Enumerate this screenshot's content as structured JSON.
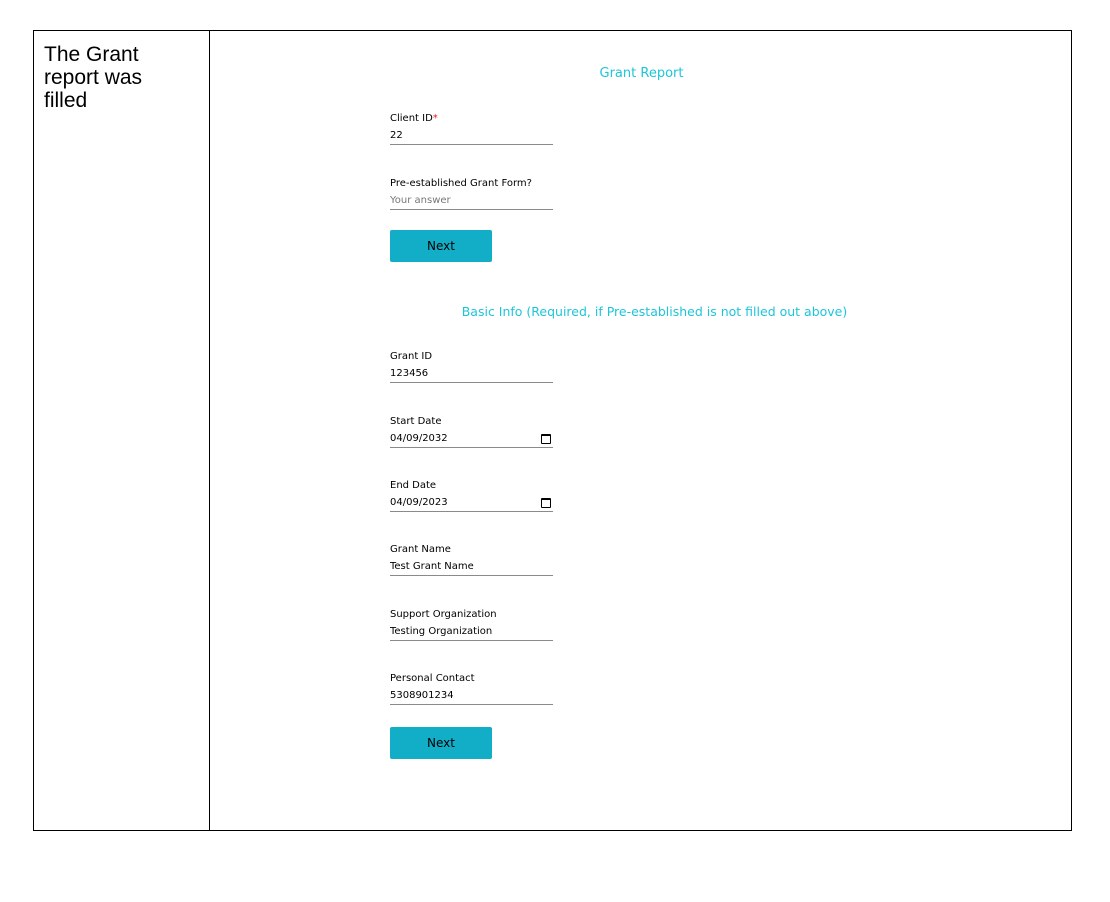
{
  "caption": "The Grant report was filled",
  "form": {
    "title": "Grant Report",
    "client_id": {
      "label": "Client ID",
      "required_mark": "*",
      "value": "22"
    },
    "pre_established": {
      "label": "Pre-established Grant Form?",
      "placeholder": "Your answer"
    },
    "next_label_1": "Next",
    "section_title": "Basic Info (Required, if Pre-established is not filled out above)",
    "grant_id": {
      "label": "Grant ID",
      "value": "123456"
    },
    "start_date": {
      "label": "Start Date",
      "value": "04/09/2032"
    },
    "end_date": {
      "label": "End Date",
      "value": "04/09/2023"
    },
    "grant_name": {
      "label": "Grant Name",
      "value": "Test Grant Name"
    },
    "support_org": {
      "label": "Support Organization",
      "value": "Testing Organization"
    },
    "personal_contact": {
      "label": "Personal Contact",
      "value": "5308901234"
    },
    "next_label_2": "Next"
  },
  "colors": {
    "accent_text": "#1ec5d9",
    "button": "#12aec8",
    "required": "#e02020"
  },
  "icons": {
    "date_picker": "calendar-icon"
  }
}
